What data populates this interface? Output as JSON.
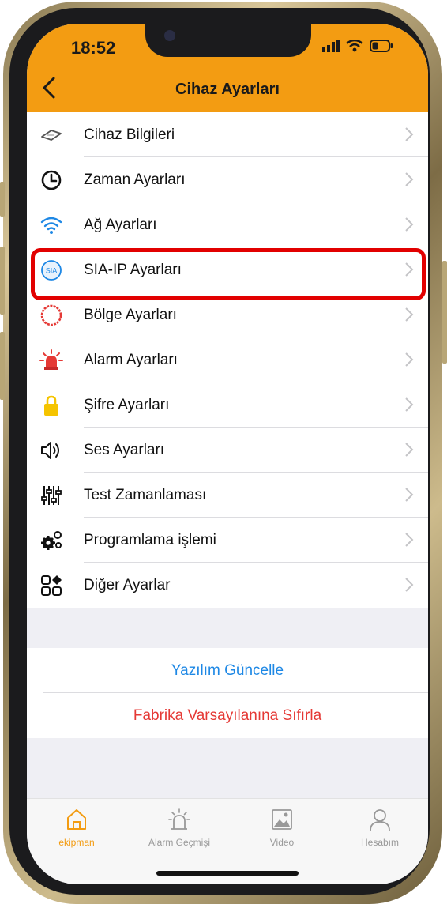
{
  "status": {
    "time": "18:52"
  },
  "header": {
    "title": "Cihaz Ayarları"
  },
  "menu": [
    {
      "label": "Cihaz Bilgileri",
      "icon": "device-info-icon"
    },
    {
      "label": "Zaman Ayarları",
      "icon": "clock-icon"
    },
    {
      "label": "Ağ Ayarları",
      "icon": "wifi-icon"
    },
    {
      "label": "SIA-IP Ayarları",
      "icon": "sia-icon"
    },
    {
      "label": "Bölge Ayarları",
      "icon": "zone-ring-icon"
    },
    {
      "label": "Alarm Ayarları",
      "icon": "siren-icon"
    },
    {
      "label": "Şifre Ayarları",
      "icon": "lock-icon"
    },
    {
      "label": "Ses Ayarları",
      "icon": "speaker-icon"
    },
    {
      "label": "Test Zamanlaması",
      "icon": "sliders-icon"
    },
    {
      "label": "Programlama işlemi",
      "icon": "gears-icon"
    },
    {
      "label": "Diğer Ayarlar",
      "icon": "grid-icon"
    }
  ],
  "actions": {
    "update": "Yazılım Güncelle",
    "reset": "Fabrika Varsayılanına Sıfırla"
  },
  "tabs": [
    {
      "label": "ekipman",
      "icon": "home-icon",
      "active": true
    },
    {
      "label": "Alarm Geçmişi",
      "icon": "alarm-light-icon",
      "active": false
    },
    {
      "label": "Video",
      "icon": "image-icon",
      "active": false
    },
    {
      "label": "Hesabım",
      "icon": "person-icon",
      "active": false
    }
  ],
  "colors": {
    "header": "#f39c12",
    "accent_active": "#f39c12",
    "update_text": "#1e88e5",
    "reset_text": "#e53935",
    "highlight": "#e20000"
  }
}
